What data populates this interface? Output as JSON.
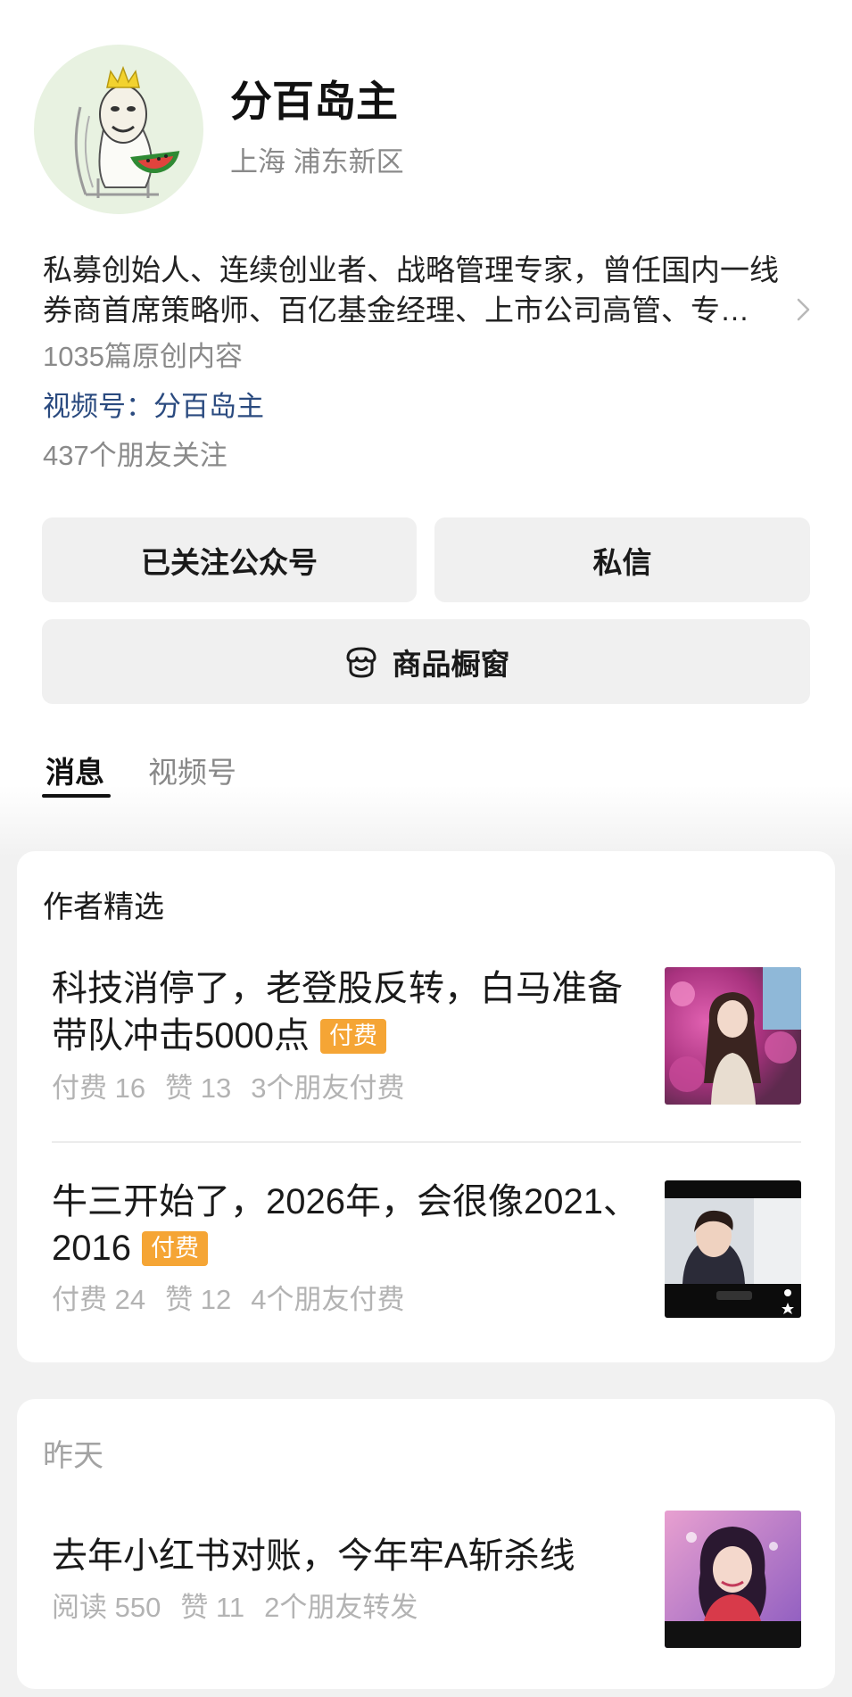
{
  "profile": {
    "name": "分百岛主",
    "location": "上海 浦东新区",
    "bio_lines": [
      "私募创始人、连续创业者、战略管理专家，曾任国内一线",
      "券商首席策略师、百亿基金经理、上市公司高管、专…"
    ],
    "original_count": "1035篇原创内容",
    "channel_label": "视频号：",
    "channel_name": "分百岛主",
    "friends_following": "437个朋友关注"
  },
  "actions": {
    "followed": "已关注公众号",
    "message": "私信",
    "shop": "商品橱窗"
  },
  "tabs": [
    {
      "label": "消息",
      "active": true
    },
    {
      "label": "视频号",
      "active": false
    }
  ],
  "featured": {
    "heading": "作者精选",
    "articles": [
      {
        "title_lines": [
          "科技消停了，老登股反转，白马准备",
          "带队冲击5000点"
        ],
        "badge": "付费",
        "stats": [
          "付费 16",
          "赞 13",
          "3个朋友付费"
        ],
        "thumbnail": "photo-thumbnail"
      },
      {
        "title_lines": [
          "牛三开始了，2026年，会很像2021、",
          "2016"
        ],
        "badge": "付费",
        "stats": [
          "付费 24",
          "赞 12",
          "4个朋友付费"
        ],
        "thumbnail": "video-thumbnail"
      }
    ]
  },
  "recent": {
    "heading": "昨天",
    "articles": [
      {
        "title_lines": [
          "去年小红书对账，今年牢A斩杀线"
        ],
        "stats": [
          "阅读 550",
          "赞 11",
          "2个朋友转发"
        ],
        "thumbnail": "photo-thumbnail"
      }
    ]
  },
  "icons": {
    "chevron": "chevron-right-icon",
    "shop": "shop-icon"
  },
  "colors": {
    "link": "#2a4a7f",
    "badge": "#f5a535",
    "muted": "#8a8a8a",
    "meta": "#b3b3b3"
  }
}
